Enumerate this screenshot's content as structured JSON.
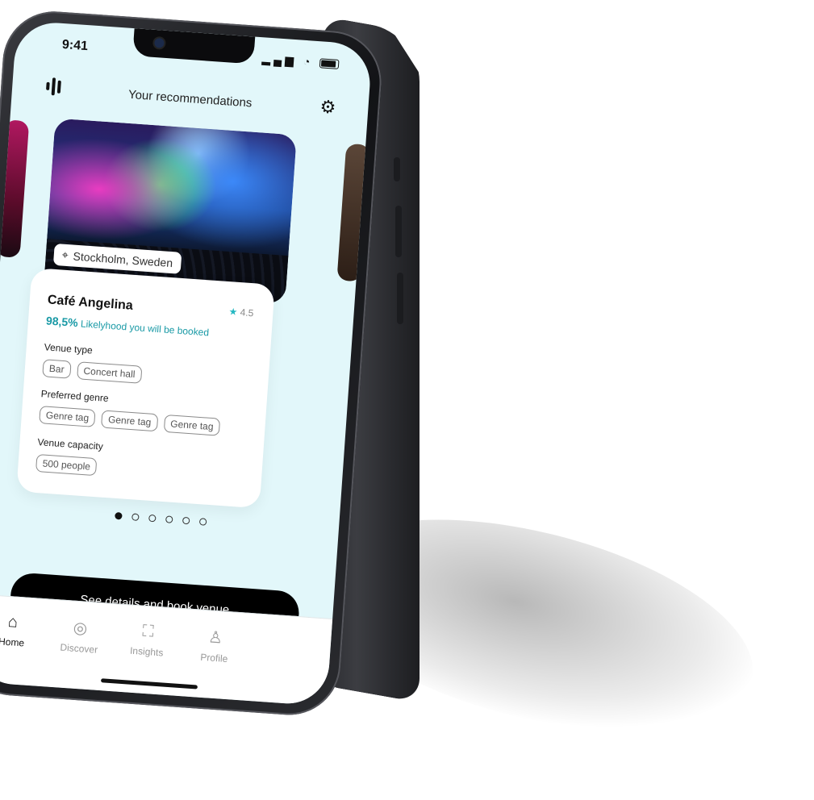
{
  "status": {
    "time": "9:41",
    "signal": "▂▄▆",
    "wifi": "wifi-icon",
    "battery": "battery-icon"
  },
  "header": {
    "title": "Your recommendations",
    "logo": "bars-logo-icon",
    "settings_icon": "gear-icon"
  },
  "card": {
    "location": "Stockholm, Sweden",
    "venue_name": "Café Angelina",
    "rating": "4.5",
    "likelihood_percent": "98,5%",
    "likelihood_text": "Likelyhood you will be booked",
    "venue_type_label": "Venue type",
    "venue_types": [
      "Bar",
      "Concert hall"
    ],
    "genre_label": "Preferred genre",
    "genres": [
      "Genre tag",
      "Genre tag",
      "Genre tag"
    ],
    "capacity_label": "Venue capacity",
    "capacity": "500 people"
  },
  "pagination": {
    "count": 6,
    "active": 1
  },
  "cta": {
    "label": "See details and book venue"
  },
  "tabs": [
    {
      "label": "Home",
      "icon": "home-icon",
      "active": true
    },
    {
      "label": "Discover",
      "icon": "compass-icon",
      "active": false
    },
    {
      "label": "Insights",
      "icon": "chart-icon",
      "active": false
    },
    {
      "label": "Profile",
      "icon": "profile-icon",
      "active": false
    }
  ],
  "colors": {
    "accent": "#1a9aa6",
    "screen_bg": "#e2f7fa",
    "cta_bg": "#000000"
  }
}
